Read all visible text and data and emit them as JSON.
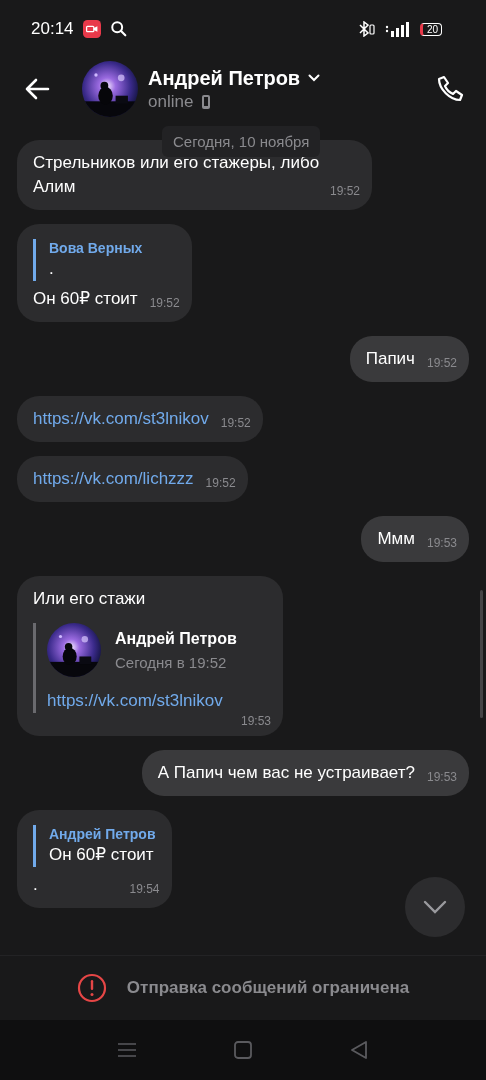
{
  "status_bar": {
    "time": "20:14",
    "battery": "20"
  },
  "header": {
    "name": "Андрей Петров",
    "status": "online"
  },
  "date_label": "Сегодня, 10 ноября",
  "messages": [
    {
      "kind": "text",
      "outgoing": false,
      "text": "Стрельников или его стажеры, либо Алим",
      "time": "19:52"
    },
    {
      "kind": "reply",
      "outgoing": false,
      "quote_author": "Вова Верных",
      "quote_text": ".",
      "text": "Он 60₽ стоит",
      "time": "19:52"
    },
    {
      "kind": "text",
      "outgoing": true,
      "text": "Папич",
      "time": "19:52"
    },
    {
      "kind": "link",
      "outgoing": false,
      "text": "https://vk.com/st3lnikov",
      "time": "19:52"
    },
    {
      "kind": "link",
      "outgoing": false,
      "text": "https://vk.com/lichzzz",
      "time": "19:52"
    },
    {
      "kind": "text",
      "outgoing": true,
      "text": "Ммм",
      "time": "19:53"
    },
    {
      "kind": "forward",
      "outgoing": false,
      "text": "Или его стажи",
      "forward_author": "Андрей Петров",
      "forward_time": "Сегодня в 19:52",
      "forward_text": "https://vk.com/st3lnikov",
      "time": "19:53"
    },
    {
      "kind": "text",
      "outgoing": true,
      "text": "А Папич чем вас не устраивает?",
      "time": "19:53"
    },
    {
      "kind": "reply",
      "outgoing": false,
      "quote_author": "Андрей Петров",
      "quote_text": "Он 60₽ стоит",
      "text": ".",
      "time": "19:54"
    }
  ],
  "notice": "Отправка сообщений ограничена"
}
